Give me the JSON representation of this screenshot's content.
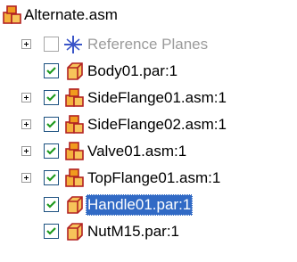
{
  "tree": {
    "root": {
      "label": "Alternate.asm",
      "icon": "assembly-icon"
    },
    "items": [
      {
        "label": "Reference Planes",
        "icon": "reference-planes-icon",
        "checked": false,
        "expandable": true,
        "dimmed": true,
        "selected": false
      },
      {
        "label": "Body01.par:1",
        "icon": "part-icon",
        "checked": true,
        "expandable": false,
        "dimmed": false,
        "selected": false
      },
      {
        "label": "SideFlange01.asm:1",
        "icon": "assembly-icon",
        "checked": true,
        "expandable": true,
        "dimmed": false,
        "selected": false
      },
      {
        "label": "SideFlange02.asm:1",
        "icon": "assembly-icon",
        "checked": true,
        "expandable": true,
        "dimmed": false,
        "selected": false
      },
      {
        "label": "Valve01.asm:1",
        "icon": "assembly-icon",
        "checked": true,
        "expandable": true,
        "dimmed": false,
        "selected": false
      },
      {
        "label": "TopFlange01.asm:1",
        "icon": "assembly-icon",
        "checked": true,
        "expandable": true,
        "dimmed": false,
        "selected": false
      },
      {
        "label": "Handle01.par:1",
        "icon": "part-icon",
        "checked": true,
        "expandable": false,
        "dimmed": false,
        "selected": true
      },
      {
        "label": "NutM15.par:1",
        "icon": "part-icon",
        "checked": true,
        "expandable": false,
        "dimmed": false,
        "selected": false
      }
    ]
  },
  "colors": {
    "selection": "#316ac5",
    "icon_orange": "#f0a020",
    "icon_red": "#c0141b",
    "planes_blue": "#3a55c8"
  }
}
